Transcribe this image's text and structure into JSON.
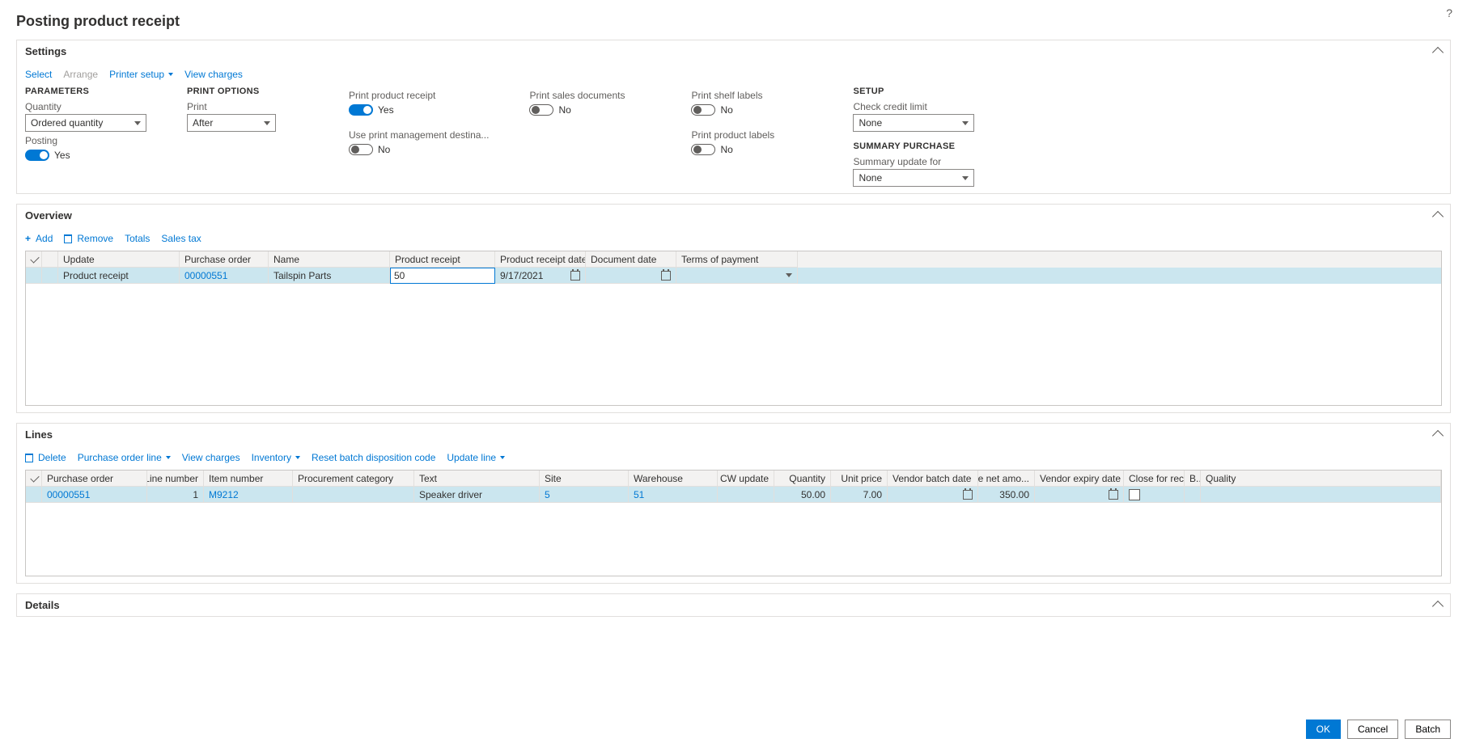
{
  "page_title": "Posting product receipt",
  "help_tooltip": "?",
  "sections": {
    "settings": {
      "title": "Settings",
      "toolbar": {
        "select": "Select",
        "arrange": "Arrange",
        "printer_setup": "Printer setup",
        "view_charges": "View charges"
      },
      "parameters": {
        "heading": "PARAMETERS",
        "quantity_label": "Quantity",
        "quantity_value": "Ordered quantity",
        "posting_label": "Posting",
        "posting_value": "Yes"
      },
      "print_options": {
        "heading": "PRINT OPTIONS",
        "print_label": "Print",
        "print_value": "After"
      },
      "toggles_col1": {
        "print_product_receipt_label": "Print product receipt",
        "print_product_receipt_value": "Yes",
        "use_print_mgmt_label": "Use print management destina...",
        "use_print_mgmt_value": "No"
      },
      "toggles_col2": {
        "print_sales_docs_label": "Print sales documents",
        "print_sales_docs_value": "No"
      },
      "toggles_col3": {
        "print_shelf_labels_label": "Print shelf labels",
        "print_shelf_labels_value": "No",
        "print_product_labels_label": "Print product labels",
        "print_product_labels_value": "No"
      },
      "setup": {
        "heading": "SETUP",
        "check_credit_label": "Check credit limit",
        "check_credit_value": "None",
        "summary_heading": "SUMMARY PURCHASE",
        "summary_update_label": "Summary update for",
        "summary_update_value": "None"
      }
    },
    "overview": {
      "title": "Overview",
      "toolbar": {
        "add": "Add",
        "remove": "Remove",
        "totals": "Totals",
        "sales_tax": "Sales tax"
      },
      "columns": {
        "update": "Update",
        "purchase_order": "Purchase order",
        "name": "Name",
        "product_receipt": "Product receipt",
        "product_receipt_date": "Product receipt date",
        "document_date": "Document date",
        "terms_of_payment": "Terms of payment"
      },
      "row": {
        "update": "Product receipt",
        "purchase_order": "00000551",
        "name": "Tailspin Parts",
        "product_receipt": "50",
        "product_receipt_date": "9/17/2021",
        "document_date": "",
        "terms_of_payment": ""
      }
    },
    "lines": {
      "title": "Lines",
      "toolbar": {
        "delete": "Delete",
        "purchase_order_line": "Purchase order line",
        "view_charges": "View charges",
        "inventory": "Inventory",
        "reset_batch": "Reset batch disposition code",
        "update_line": "Update line"
      },
      "columns": {
        "purchase_order": "Purchase order",
        "line_number": "Line number",
        "item_number": "Item number",
        "procurement_category": "Procurement category",
        "text": "Text",
        "site": "Site",
        "warehouse": "Warehouse",
        "cw_update": "CW update",
        "quantity": "Quantity",
        "unit_price": "Unit price",
        "vendor_batch_date": "Vendor batch date",
        "line_net_amount": "Line net amo...",
        "vendor_expiry_date": "Vendor expiry date",
        "close_for_receipt": "Close for rec...",
        "b": "B...",
        "quality": "Quality"
      },
      "row": {
        "purchase_order": "00000551",
        "line_number": "1",
        "item_number": "M9212",
        "procurement_category": "",
        "text": "Speaker driver",
        "site": "5",
        "warehouse": "51",
        "cw_update": "",
        "quantity": "50.00",
        "unit_price": "7.00",
        "vendor_batch_date": "",
        "line_net_amount": "350.00",
        "vendor_expiry_date": "",
        "close_for_receipt": false
      }
    },
    "details": {
      "title": "Details"
    }
  },
  "footer": {
    "ok": "OK",
    "cancel": "Cancel",
    "batch": "Batch"
  }
}
